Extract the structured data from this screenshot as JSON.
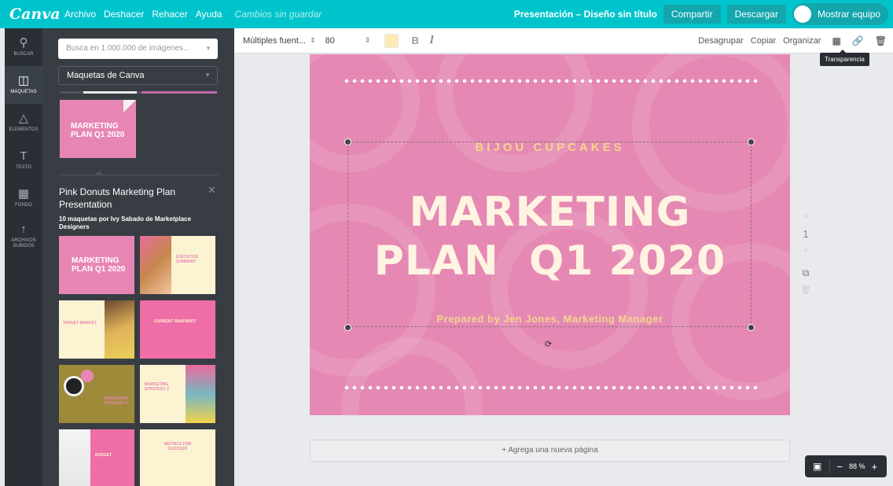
{
  "app": {
    "logo": "Canva"
  },
  "menu": [
    "Archivo",
    "Deshacer",
    "Rehacer",
    "Ayuda"
  ],
  "unsaved_status": "Cambios sin guardar",
  "document_title": "Presentación – Diseño sin título",
  "header_buttons": {
    "share": "Compartir",
    "download": "Descargar",
    "team": "Mostrar equipo"
  },
  "rail": [
    {
      "label": "Buscar",
      "icon": "search-icon"
    },
    {
      "label": "Maquetas",
      "icon": "layout-icon"
    },
    {
      "label": "Elementos",
      "icon": "shapes-icon"
    },
    {
      "label": "Texto",
      "icon": "text-icon"
    },
    {
      "label": "Fondo",
      "icon": "background-icon"
    },
    {
      "label": "Archivos subidos",
      "icon": "upload-icon"
    }
  ],
  "panel": {
    "search_placeholder": "Busca en 1.000.000 de imágenes...",
    "filter_value": "Maquetas de Canva",
    "selected_card_text": "MARKETING PLAN Q1 2020",
    "set_title": "Pink Donuts Marketing Plan Presentation",
    "set_subtitle": "10 maquetas por Ivy Sabado de Marketplace Designers",
    "thumbs": [
      {
        "label": "MARKETING PLAN Q1 2020"
      },
      {
        "label": "EXECUTIVE SUMMARY"
      },
      {
        "label": "TARGET MARKET"
      },
      {
        "label": "CURRENT SNAPSHOT"
      },
      {
        "label": "MARKETING STRATEGY 1"
      },
      {
        "label": "MARKETING STRATEGY 2"
      },
      {
        "label": "BUDGET"
      },
      {
        "label": "METRICS FOR SUCCESS"
      }
    ]
  },
  "toolbar": {
    "font": "Múltiples fuent...",
    "size": "80",
    "bold": "B",
    "italic": "I",
    "ungroup": "Desagrupar",
    "copy": "Copiar",
    "arrange": "Organizar",
    "tooltip": "Transparencia"
  },
  "slide": {
    "brand": "BIJOU CUPCAKES",
    "headline_line1": "MARKETING",
    "headline_line2": "PLAN  Q1 2020",
    "byline": "Prepared by Jen Jones, Marketing Manager"
  },
  "page_number": "1",
  "add_page": "+ Agrega una nueva página",
  "zoom": {
    "level": "88 %"
  },
  "colors": {
    "brand_teal": "#00c4cc",
    "slide_pink": "#e589b4",
    "accent_gold": "#f4d58a"
  }
}
